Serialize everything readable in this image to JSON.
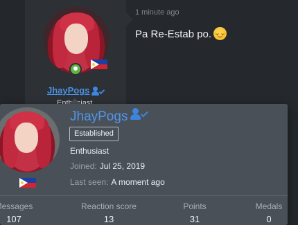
{
  "post": {
    "time": "1 minute ago",
    "message": "Pa Re-Estab po.",
    "emoji": "smiling-face-emoji"
  },
  "author": {
    "username": "JhayPogs",
    "title_partial": "Enthusiast",
    "status_icon": "online-icon",
    "flag": "philippines-flag",
    "verified_icon": "user-check-icon"
  },
  "popup": {
    "username": "JhayPogs",
    "badge": "Established",
    "title": "Enthusiast",
    "joined_label": "Joined:",
    "joined_value": "Jul 25, 2019",
    "lastseen_label": "Last seen:",
    "lastseen_value": "A moment ago",
    "stats": [
      {
        "label": "Messages",
        "value": "107"
      },
      {
        "label": "Reaction score",
        "value": "13"
      },
      {
        "label": "Points",
        "value": "31"
      },
      {
        "label": "Medals",
        "value": "0"
      }
    ]
  },
  "colors": {
    "accent": "#4e97ea",
    "popup_bg": "#4a5058",
    "page_bg": "#24272b",
    "online": "#63b346"
  }
}
